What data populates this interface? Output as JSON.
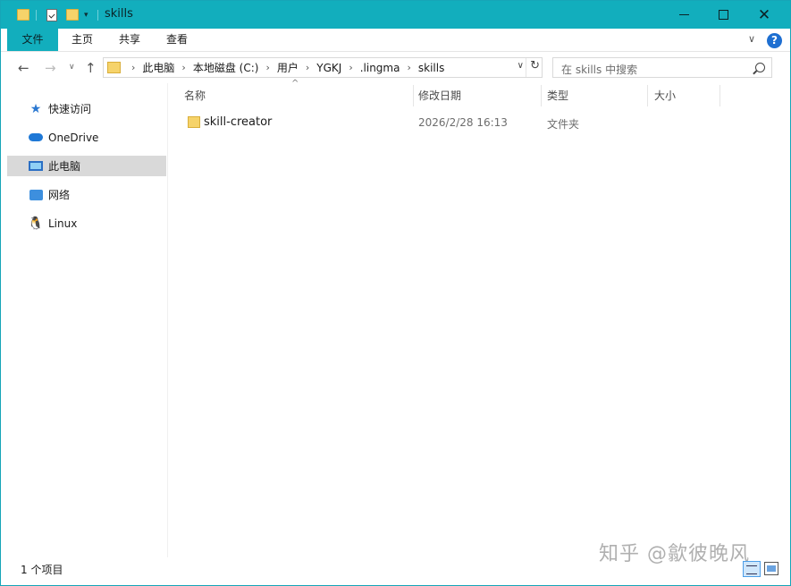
{
  "window": {
    "title": "skills",
    "accent": "#12aebd"
  },
  "quick_access_toolbar": {
    "icons": [
      "folder-icon",
      "properties-icon",
      "new-folder-icon",
      "customize-dropdown-icon"
    ]
  },
  "window_controls": {
    "minimize_icon": "minimize-icon",
    "maximize_icon": "maximize-icon",
    "close_glyph": "✕"
  },
  "ribbon": {
    "tabs": [
      {
        "label": "文件"
      },
      {
        "label": "主页"
      },
      {
        "label": "共享"
      },
      {
        "label": "查看"
      }
    ],
    "collapse_glyph": "∨",
    "help_glyph": "?"
  },
  "navigation": {
    "back_glyph": "←",
    "forward_glyph": "→",
    "recent_glyph": "∨",
    "up_glyph": "↑"
  },
  "address_bar": {
    "breadcrumbs": [
      "此电脑",
      "本地磁盘 (C:)",
      "用户",
      "YGKJ",
      ".lingma",
      "skills"
    ],
    "separator": "›",
    "dropdown_glyph": "∨",
    "refresh_glyph": "↻"
  },
  "search": {
    "placeholder": "在 skills 中搜索"
  },
  "nav_pane": {
    "items": [
      {
        "label": "快速访问",
        "icon": "quick-access-star-icon"
      },
      {
        "label": "OneDrive",
        "icon": "onedrive-cloud-icon"
      },
      {
        "label": "此电脑",
        "icon": "this-pc-icon",
        "selected": true
      },
      {
        "label": "网络",
        "icon": "network-icon"
      },
      {
        "label": "Linux",
        "icon": "linux-penguin-icon"
      }
    ]
  },
  "file_list": {
    "columns": {
      "name": "名称",
      "modified": "修改日期",
      "type": "类型",
      "size": "大小"
    },
    "sort_indicator": "^",
    "rows": [
      {
        "name": "skill-creator",
        "modified": "2026/2/28 16:13",
        "type": "文件夹",
        "size": ""
      }
    ]
  },
  "status_bar": {
    "item_count": "1 个项目",
    "views": [
      "details-view-icon",
      "large-icons-view-icon"
    ]
  },
  "watermark": "知乎 @歙彼晚风"
}
